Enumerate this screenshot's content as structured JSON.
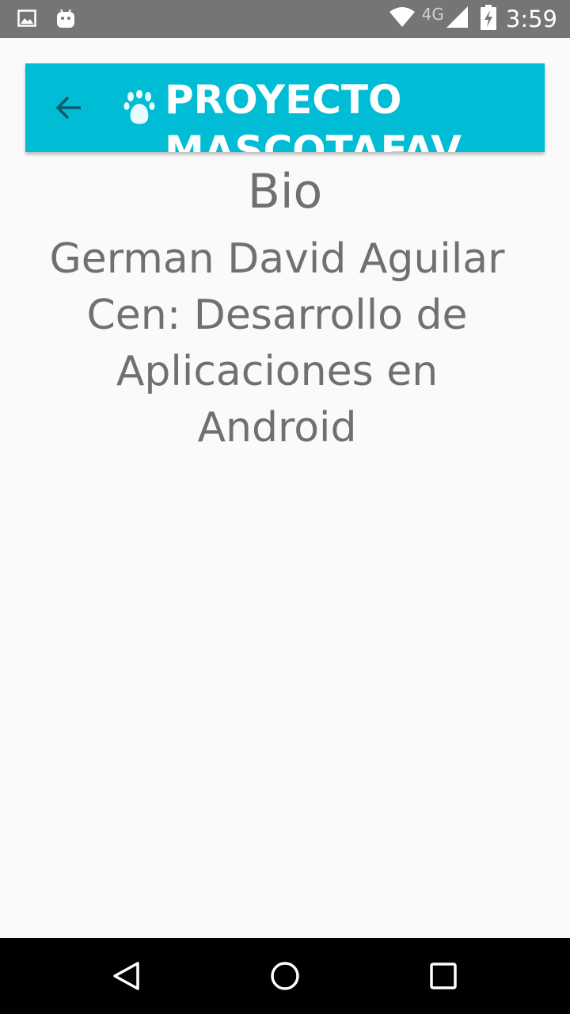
{
  "status_bar": {
    "network": "4G",
    "time": "3:59",
    "icons": [
      "image-icon",
      "android-icon",
      "wifi-icon",
      "signal-icon",
      "battery-charging-icon"
    ]
  },
  "app_bar": {
    "title": "PROYECTO MASCOTAFAV",
    "back_icon": "arrow-back-icon",
    "logo_icon": "paw-icon",
    "background": "#00bcd4"
  },
  "content": {
    "heading": "Bio",
    "bio_text": "German David Aguilar Cen: Desarrollo de Aplicaciones en Android"
  },
  "nav_bar": {
    "icons": [
      "back-triangle-icon",
      "home-circle-icon",
      "recents-square-icon"
    ]
  }
}
